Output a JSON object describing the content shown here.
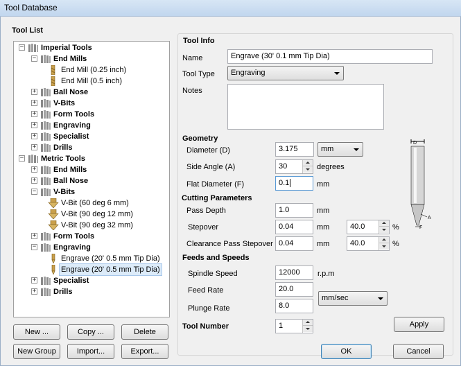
{
  "window": {
    "title": "Tool Database"
  },
  "tool_list": {
    "heading": "Tool List",
    "nodes": [
      {
        "label": "Imperial Tools",
        "exp": "⊟",
        "icon": "tool-group-icon"
      },
      {
        "label": "End Mills",
        "exp": "⊟",
        "icon": "tool-group-icon"
      },
      {
        "label": "End Mill (0.25 inch)",
        "exp": "",
        "icon": "end-mill-icon"
      },
      {
        "label": "End Mill (0.5 inch)",
        "exp": "",
        "icon": "end-mill-icon"
      },
      {
        "label": "Ball Nose",
        "exp": "⊞",
        "icon": "tool-group-icon"
      },
      {
        "label": "V-Bits",
        "exp": "⊞",
        "icon": "tool-group-icon"
      },
      {
        "label": "Form Tools",
        "exp": "⊞",
        "icon": "tool-group-icon"
      },
      {
        "label": "Engraving",
        "exp": "⊞",
        "icon": "tool-group-icon"
      },
      {
        "label": "Specialist",
        "exp": "⊞",
        "icon": "tool-group-icon"
      },
      {
        "label": "Drills",
        "exp": "⊞",
        "icon": "tool-group-icon"
      },
      {
        "label": "Metric Tools",
        "exp": "⊟",
        "icon": "tool-group-icon"
      },
      {
        "label": "End Mills",
        "exp": "⊞",
        "icon": "tool-group-icon"
      },
      {
        "label": "Ball Nose",
        "exp": "⊞",
        "icon": "tool-group-icon"
      },
      {
        "label": "V-Bits",
        "exp": "⊟",
        "icon": "tool-group-icon"
      },
      {
        "label": "V-Bit (60 deg 6 mm)",
        "exp": "",
        "icon": "v-bit-icon"
      },
      {
        "label": "V-Bit (90 deg 12 mm)",
        "exp": "",
        "icon": "v-bit-icon"
      },
      {
        "label": "V-Bit (90 deg 32 mm)",
        "exp": "",
        "icon": "v-bit-icon"
      },
      {
        "label": "Form Tools",
        "exp": "⊞",
        "icon": "tool-group-icon"
      },
      {
        "label": "Engraving",
        "exp": "⊟",
        "icon": "tool-group-icon"
      },
      {
        "label": "Engrave (20' 0.5 mm Tip Dia)",
        "exp": "",
        "icon": "engrave-tool-icon"
      },
      {
        "label": "Engrave (20' 0.5 mm Tip Dia)",
        "exp": "",
        "icon": "engrave-tool-icon"
      },
      {
        "label": "Specialist",
        "exp": "⊞",
        "icon": "tool-group-icon"
      },
      {
        "label": "Drills",
        "exp": "⊞",
        "icon": "tool-group-icon"
      }
    ],
    "buttons": {
      "new": "New ...",
      "copy": "Copy ...",
      "delete": "Delete",
      "new_group": "New Group",
      "import": "Import...",
      "export": "Export..."
    }
  },
  "tool_info": {
    "heading": "Tool Info",
    "name_label": "Name",
    "name_value": "Engrave (30' 0.1 mm Tip Dia)",
    "type_label": "Tool Type",
    "type_value": "Engraving",
    "notes_label": "Notes",
    "notes_value": ""
  },
  "geometry": {
    "heading": "Geometry",
    "diameter_label": "Diameter (D)",
    "diameter_value": "3.175",
    "units_value": "mm",
    "side_angle_label": "Side Angle (A)",
    "side_angle_value": "30",
    "side_angle_unit": "degrees",
    "flat_label": "Flat Diameter (F)",
    "flat_value": "0.1",
    "flat_unit": "mm",
    "diagram_labels": {
      "d": "D",
      "a": "A",
      "f": "F"
    }
  },
  "cutting": {
    "heading": "Cutting Parameters",
    "pass_depth_label": "Pass Depth",
    "pass_depth_value": "1.0",
    "pass_depth_unit": "mm",
    "stepover_label": "Stepover",
    "stepover_value": "0.04",
    "stepover_unit": "mm",
    "stepover_pct": "40.0",
    "clearance_label": "Clearance Pass Stepover",
    "clearance_value": "0.04",
    "clearance_unit": "mm",
    "clearance_pct": "40.0",
    "pct_symbol": "%"
  },
  "feeds": {
    "heading": "Feeds and Speeds",
    "spindle_label": "Spindle Speed",
    "spindle_value": "12000",
    "spindle_unit": "r.p.m",
    "feed_label": "Feed Rate",
    "feed_value": "20.0",
    "plunge_label": "Plunge Rate",
    "plunge_value": "8.0",
    "rate_units": "mm/sec"
  },
  "tool_number": {
    "label": "Tool Number",
    "value": "1"
  },
  "actions": {
    "apply": "Apply",
    "ok": "OK",
    "cancel": "Cancel"
  }
}
